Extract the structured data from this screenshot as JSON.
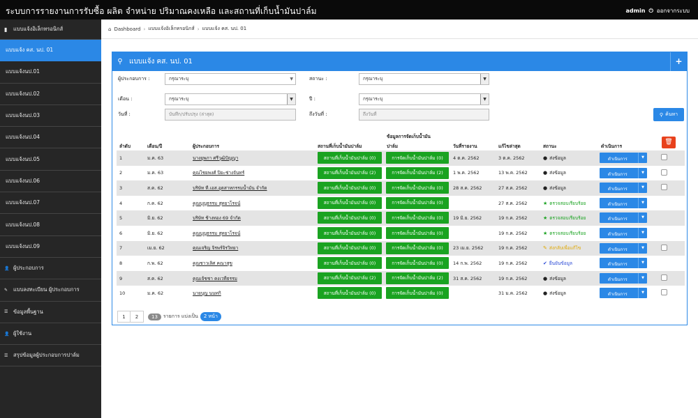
{
  "app": {
    "title": "ระบบการรายงานการรับซื้อ ผลิต จำหน่าย ปริมาณคงเหลือ และสถานที่เก็บน้ำมันปาล์ม",
    "user": "admin",
    "logout": "ออกจากระบบ"
  },
  "sidebar": {
    "section": "แบบแจ้งอิเล็กทรอนิกส์",
    "items": [
      "แบบแจ้ง คส. นป. 01",
      "แบบแจ้งนป.01",
      "แบบแจ้งนป.02",
      "แบบแจ้งนป.03",
      "แบบแจ้งนป.04",
      "แบบแจ้งนป.05",
      "แบบแจ้งนป.06",
      "แบบแจ้งนป.07",
      "แบบแจ้งนป.08",
      "แบบแจ้งนป.09"
    ],
    "menus": [
      "ผู้ประกอบการ",
      "แบบลงทะเบียน ผู้ประกอบการ",
      "ข้อมูลพื้นฐาน",
      "ผู้ใช้งาน",
      "สรุปข้อมูลผู้ประกอบการปาล์ม"
    ]
  },
  "breadcrumb": [
    "Dashboard",
    "แบบแจ้งอิเล็กทรอนิกส์",
    "แบบแจ้ง คส. นป. 01"
  ],
  "panel": {
    "title": "แบบแจ้ง คส. นป. 01"
  },
  "filters": {
    "operator_label": "ผู้ประกอบการ :",
    "operator_value": "กรุณาระบุ",
    "status_label": "สถานะ :",
    "status_value": "กรุณาระบุ",
    "month_label": "เดือน :",
    "month_value": "กรุณาระบุ",
    "year_label": "ปี :",
    "year_value": "กรุณาระบุ",
    "date_label": "วันที่ :",
    "date_placeholder": "บันทึก/ปรับปรุง (ล่าสุด)",
    "todate_label": "ถึงวันที่ :",
    "todate_placeholder": "ถึงวันที่",
    "search": "ค้นหา"
  },
  "table": {
    "headers": [
      "ลำดับ",
      "เดือน/ปี",
      "ผู้ประกอบการ",
      "สถานที่เก็บน้ำมันปาล์ม",
      "ข้อมูลการจัดเก็บน้ำมัน",
      "ปาล์ม",
      "วันที่รายงาน",
      "แก้ไขล่าสุด",
      "สถานะ",
      "ดำเนินการ"
    ],
    "action_label": "ดำเนินการ",
    "rows": [
      {
        "no": "1",
        "month": "ม.ค. 63",
        "operator": "นางยุพภา ศรีวุฒิปัญญา",
        "place": "สถานที่เก็บน้ำมันปาล์ม (0)",
        "store": "การจัดเก็บน้ำมันปาล์ม (0)",
        "reported": "4 ต.ค. 2562",
        "edited": "3 ต.ค. 2562",
        "status": "ส่งข้อมูล",
        "status_icon": "info",
        "checkbox": true
      },
      {
        "no": "2",
        "month": "ม.ค. 63",
        "operator": "คุณไชยพงศ์ ปิยะช่างจันทร์",
        "place": "สถานที่เก็บน้ำมันปาล์ม (2)",
        "store": "การจัดเก็บน้ำมันปาล์ม (2)",
        "reported": "1 พ.ค. 2562",
        "edited": "13 พ.ค. 2562",
        "status": "ส่งข้อมูล",
        "status_icon": "info",
        "checkbox": true
      },
      {
        "no": "3",
        "month": "ส.ค. 62",
        "operator": "บริษัท ที.เอส.อุตสาหกรรมน้ำมัน จำกัด",
        "place": "สถานที่เก็บน้ำมันปาล์ม (0)",
        "store": "การจัดเก็บน้ำมันปาล์ม (0)",
        "reported": "28 ส.ค. 2562",
        "edited": "27 ส.ค. 2562",
        "status": "ส่งข้อมูล",
        "status_icon": "info",
        "checkbox": true
      },
      {
        "no": "4",
        "month": "ก.ค. 62",
        "operator": "คุณบุญธรรม สุทยาโรจน์",
        "place": "สถานที่เก็บน้ำมันปาล์ม (0)",
        "store": "การจัดเก็บน้ำมันปาล์ม (0)",
        "reported": "",
        "edited": "27 ส.ค. 2562",
        "status": "ตรวจสอบเรียบร้อย",
        "status_icon": "star",
        "checkbox": false
      },
      {
        "no": "5",
        "month": "มิ.ย. 62",
        "operator": "บริษัท ช้างทอง 69 จำกัด",
        "place": "สถานที่เก็บน้ำมันปาล์ม (0)",
        "store": "การจัดเก็บน้ำมันปาล์ม (0)",
        "reported": "19 มิ.ย. 2562",
        "edited": "19 ก.ค. 2562",
        "status": "ตรวจสอบเรียบร้อย",
        "status_icon": "star",
        "checkbox": false
      },
      {
        "no": "6",
        "month": "มิ.ย. 62",
        "operator": "คุณบุญธรรม สุทยาโรจน์",
        "place": "สถานที่เก็บน้ำมันปาล์ม (0)",
        "store": "การจัดเก็บน้ำมันปาล์ม (0)",
        "reported": "",
        "edited": "19 ก.ค. 2562",
        "status": "ตรวจสอบเรียบร้อย",
        "status_icon": "star",
        "checkbox": false
      },
      {
        "no": "7",
        "month": "เม.ย. 62",
        "operator": "คุณเจริญ จิรพร์จิรวิทยา",
        "place": "สถานที่เก็บน้ำมันปาล์ม (0)",
        "store": "การจัดเก็บน้ำมันปาล์ม (0)",
        "reported": "23 เม.ย. 2562",
        "edited": "19 ก.ค. 2562",
        "status": "ส่งกลับเพื่อแก้ไข",
        "status_icon": "pencil",
        "checkbox": true
      },
      {
        "no": "8",
        "month": "ก.พ. 62",
        "operator": "คุณชาวเลิศ คณาสุข",
        "place": "สถานที่เก็บน้ำมันปาล์ม (0)",
        "store": "การจัดเก็บน้ำมันปาล์ม (0)",
        "reported": "14 ก.พ. 2562",
        "edited": "19 ก.ค. 2562",
        "status": "ยืนยันข้อมูล",
        "status_icon": "check",
        "checkbox": false
      },
      {
        "no": "9",
        "month": "ส.ค. 62",
        "operator": "คุณเจ้ชชา คงเวทีธรรม",
        "place": "สถานที่เก็บน้ำมันปาล์ม (2)",
        "store": "การจัดเก็บน้ำมันปาล์ม (2)",
        "reported": "31 ส.ค. 2562",
        "edited": "19 ก.ค. 2562",
        "status": "ส่งข้อมูล",
        "status_icon": "info",
        "checkbox": true
      },
      {
        "no": "10",
        "month": "ม.ค. 62",
        "operator": "นายบุญ นนทกิ",
        "place": "สถานที่เก็บน้ำมันปาล์ม (0)",
        "store": "การจัดเก็บน้ำมันปาล์ม (0)",
        "reported": "",
        "edited": "31 ม.ค. 2562",
        "status": "ส่งข้อมูล",
        "status_icon": "info",
        "checkbox": true
      }
    ]
  },
  "pagination": {
    "pages": [
      "1",
      "2"
    ],
    "total": "13",
    "text": "รายการ แบ่งเป็น",
    "page_count": "2 หน้า"
  },
  "colors": {
    "accent": "#2b88e6",
    "green": "#1aa321",
    "danger": "#e8411c",
    "sidebar": "#262626",
    "star": "#1aa321",
    "pencil": "#e0a800",
    "check": "#2b4ad6"
  }
}
